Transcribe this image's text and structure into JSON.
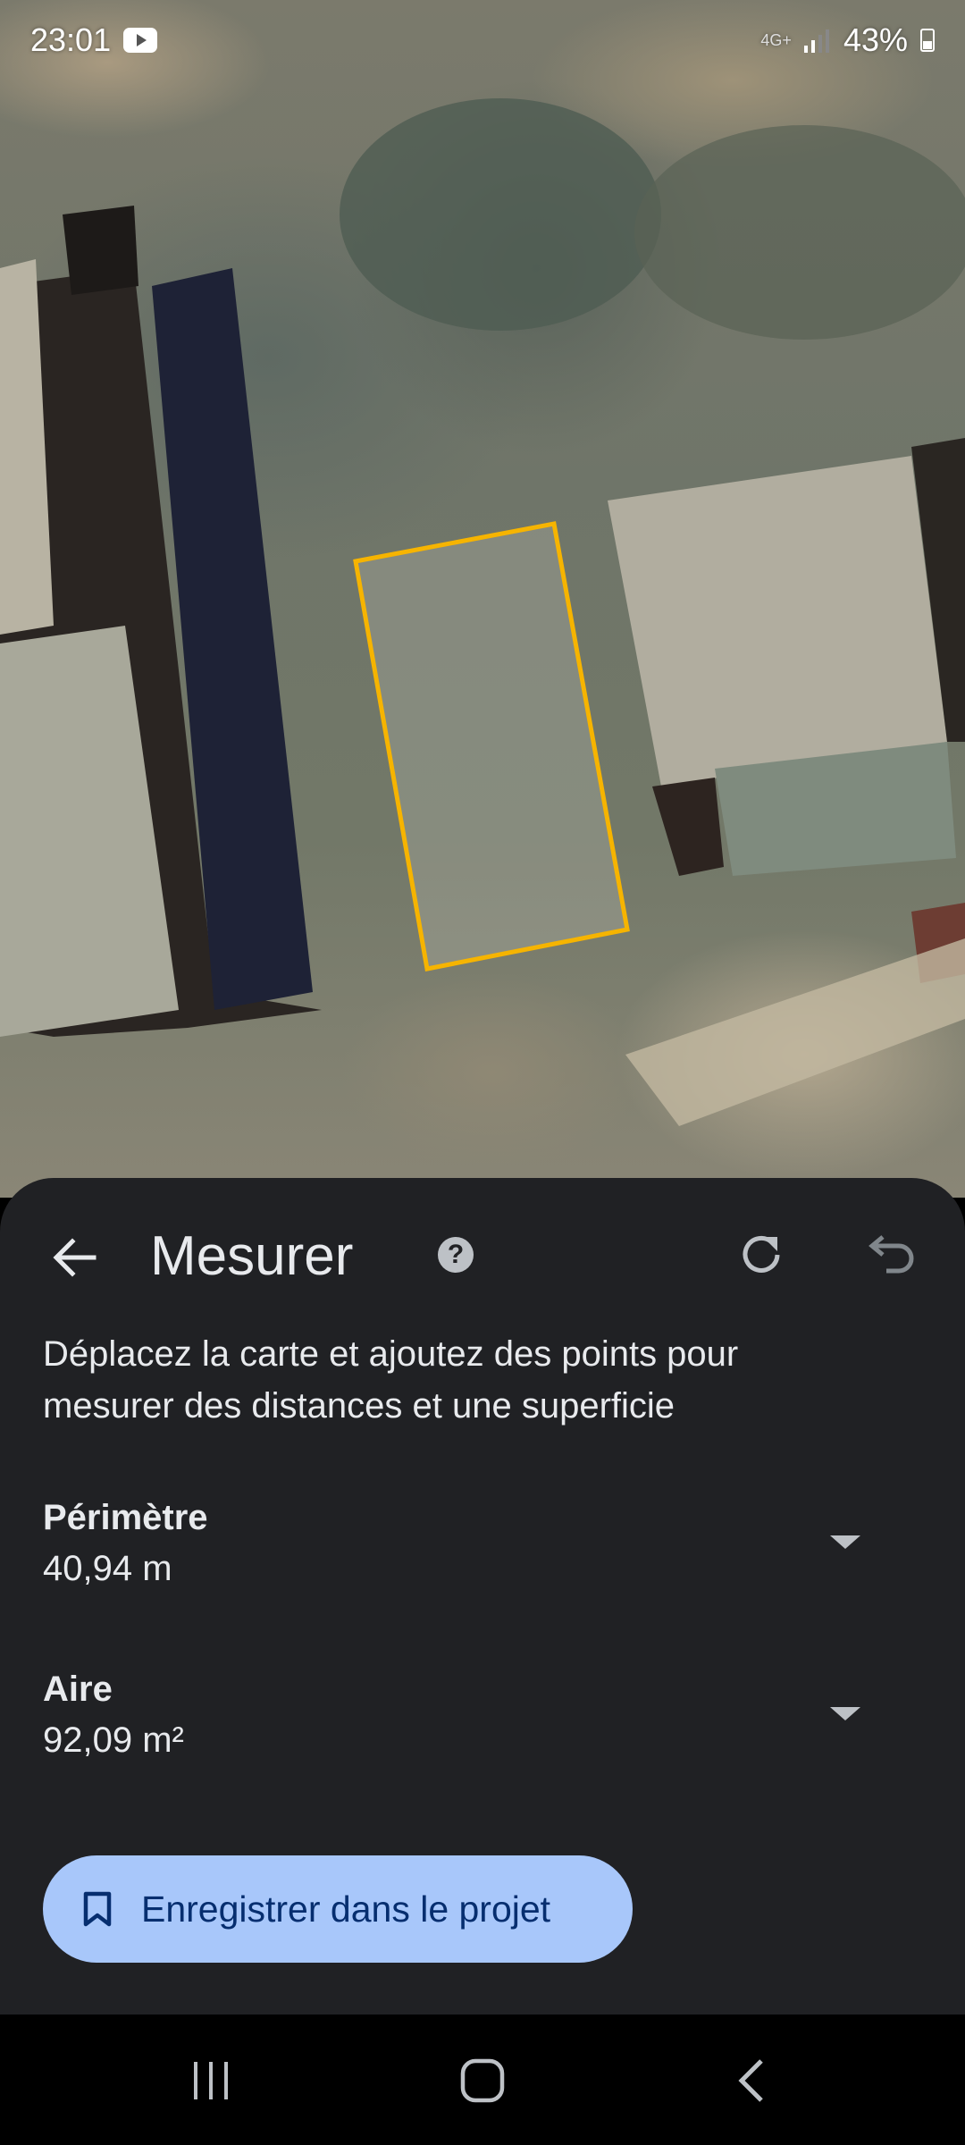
{
  "status_bar": {
    "time": "23:01",
    "network": "4G+",
    "battery": "43%",
    "icons": [
      "youtube-icon",
      "signal-icon",
      "battery-icon"
    ]
  },
  "measure": {
    "title": "Mesurer",
    "instructions": "Déplacez la carte et ajoutez des points pour mesurer des distances et une superficie",
    "perimeter": {
      "label": "Périmètre",
      "value": "40,94 m"
    },
    "area": {
      "label": "Aire",
      "value": "92,09 m²"
    },
    "save_label": "Enregistrer dans le projet"
  },
  "colors": {
    "polygon_outline": "#f6b400",
    "sheet_background": "#202124",
    "save_button": "#a8c7fa"
  }
}
